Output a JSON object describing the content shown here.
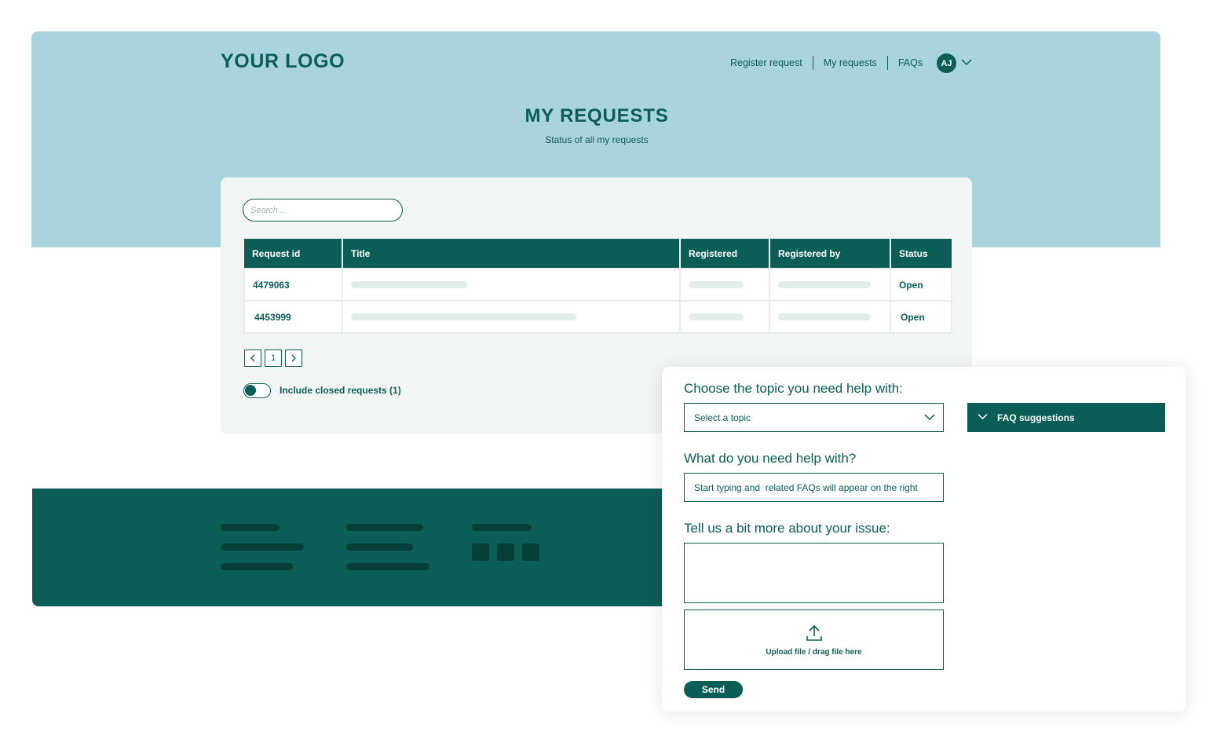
{
  "header": {
    "logo": "YOUR LOGO",
    "nav": [
      "Register request",
      "My requests",
      "FAQs"
    ],
    "user_initials": "AJ"
  },
  "hero": {
    "title": "MY REQUESTS",
    "subtitle": "Status of all my requests"
  },
  "requests": {
    "search_placeholder": "Search...",
    "columns": [
      "Request id",
      "Title",
      "Registered",
      "Registered by",
      "Status"
    ],
    "rows": [
      {
        "id": "4479063",
        "status": "Open"
      },
      {
        "id": "4453999",
        "status": "Open"
      }
    ],
    "pager": {
      "prev": "‹",
      "page": "1",
      "next": "›"
    },
    "toggle_label": "Include closed requests (1)",
    "toggle_on": true
  },
  "help_form": {
    "topic_label": "Choose the topic you need help with:",
    "topic_select": "Select a topic",
    "faq_button": "FAQ suggestions",
    "help_label": "What do you need help with?",
    "help_placeholder": "Start typing and  related FAQs will appear on the right",
    "issue_label": "Tell us a bit more about your issue:",
    "upload_text": "Upload file / drag file here",
    "send_button": "Send"
  },
  "colors": {
    "primary": "#0b5e56",
    "hero_bg": "#a9d3dd",
    "card_bg": "#f1f5f3",
    "footer_bg": "#0b5e56"
  },
  "icons": [
    "chevron-down-icon",
    "chevron-left-icon",
    "chevron-right-icon",
    "upload-icon"
  ]
}
